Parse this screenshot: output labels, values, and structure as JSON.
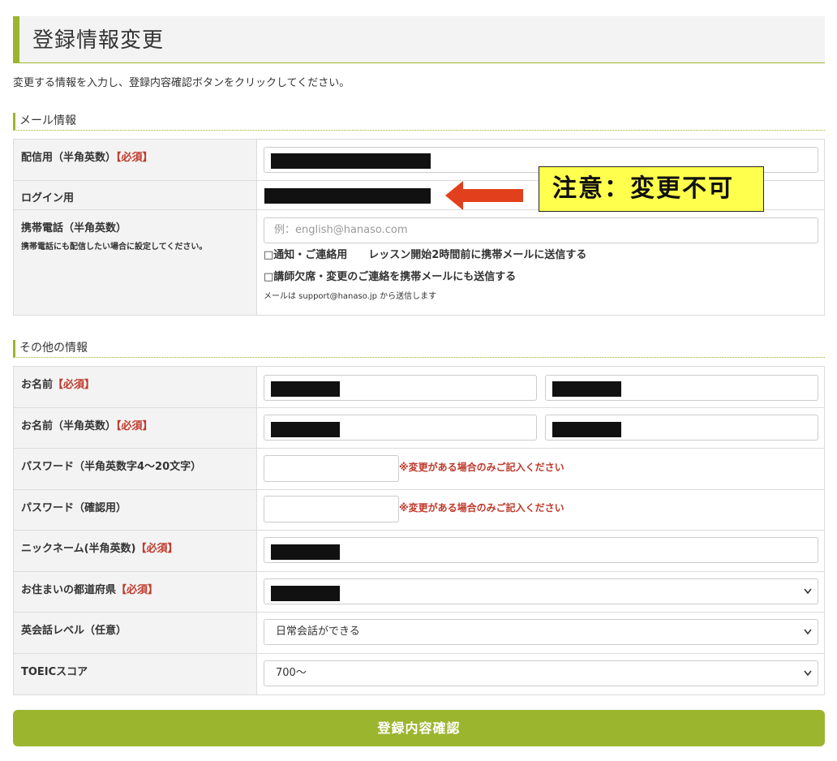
{
  "page": {
    "title": "登録情報変更",
    "intro": "変更する情報を入力し、登録内容確認ボタンをクリックしてください。"
  },
  "mail_section": {
    "heading": "メール情報",
    "delivery_label": "配信用（半角英数）",
    "required_tag": "【必須】",
    "login_label": "ログイン用",
    "mobile_label": "携帯電話（半角英数）",
    "mobile_sub": "携帯電話にも配信したい場合に設定してください。",
    "mobile_placeholder": "例：english@hanaso.com",
    "check_notify": "□通知・ご連絡用　　レッスン開始2時間前に携帯メールに送信する",
    "check_teacher": "□講師欠席・変更のご連絡を携帯メールにも送信する",
    "sender_note": "メールは support@hanaso.jp から送信します"
  },
  "other_section": {
    "heading": "その他の情報",
    "name_label": "お名前",
    "name_en_label": "お名前（半角英数）",
    "password_label": "パスワード（半角英数字4〜20文字）",
    "password_confirm_label": "パスワード（確認用）",
    "password_note": "※変更がある場合のみご記入ください",
    "nickname_label": "ニックネーム(半角英数)",
    "prefecture_label": "お住まいの都道府県",
    "english_level_label": "英会話レベル（任意）",
    "english_level_value": "日常会話ができる",
    "toeic_label": "TOEICスコア",
    "toeic_value": "700〜",
    "required_tag": "【必須】"
  },
  "submit": {
    "label": "登録内容確認"
  },
  "annotation": {
    "callout": "注意：変更不可",
    "arrow_color": "#e2401c",
    "callout_bg": "#ffff4d"
  },
  "colors": {
    "accent": "#9cb52f",
    "required": "#c0392b"
  }
}
